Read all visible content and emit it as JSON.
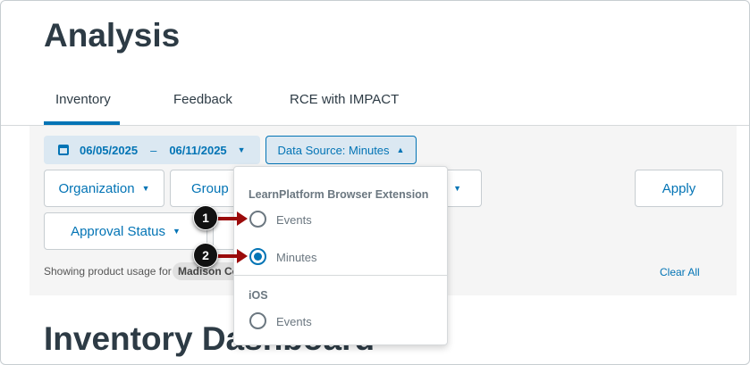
{
  "page_title": "Analysis",
  "tabs": [
    {
      "label": "Inventory",
      "active": true
    },
    {
      "label": "Feedback"
    },
    {
      "label": "RCE with IMPACT"
    }
  ],
  "filters": {
    "date_start": "06/05/2025",
    "date_sep": "–",
    "date_end": "06/11/2025",
    "data_source": "Data Source: Minutes",
    "organization": "Organization",
    "group": "Group",
    "approval_status": "Approval Status",
    "apply": "Apply",
    "showing_text": "Showing product usage for",
    "org_chip": "Madison Co",
    "clear_all": "Clear All"
  },
  "dropdown": {
    "groups": [
      {
        "label": "LearnPlatform Browser Extension",
        "options": [
          {
            "label": "Events",
            "selected": false
          },
          {
            "label": "Minutes",
            "selected": true
          }
        ]
      },
      {
        "label": "iOS",
        "options": [
          {
            "label": "Events",
            "selected": false
          }
        ]
      }
    ]
  },
  "callouts": [
    "1",
    "2"
  ],
  "dashboard_title": "Inventory Dashboard",
  "colors": {
    "accent": "#0374b5",
    "callout_arrow": "#9b0b0b"
  }
}
